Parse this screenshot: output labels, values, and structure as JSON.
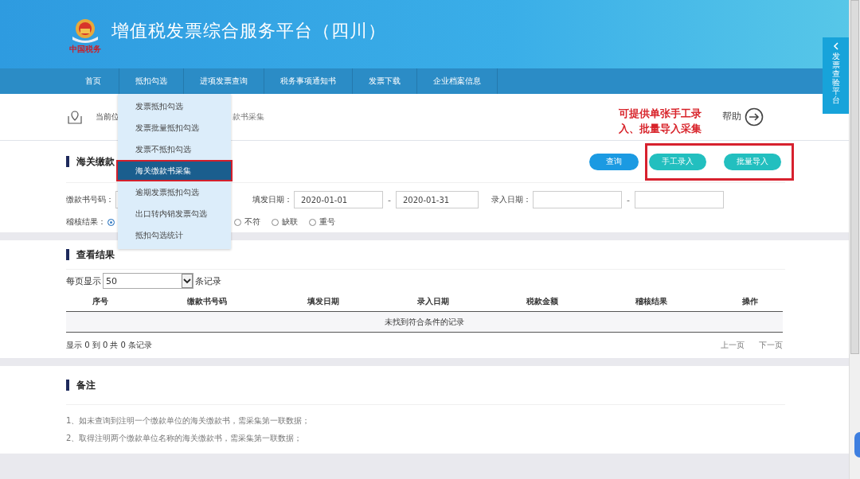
{
  "header": {
    "logo_text": "中国税务",
    "title": "增值税发票综合服务平台（四川）"
  },
  "nav": [
    {
      "label": "首页"
    },
    {
      "label": "抵扣勾选"
    },
    {
      "label": "进项发票查询"
    },
    {
      "label": "税务事项通知书"
    },
    {
      "label": "发票下载"
    },
    {
      "label": "企业档案信息"
    }
  ],
  "dropdown": {
    "items": [
      {
        "label": "发票抵扣勾选",
        "selected": false
      },
      {
        "label": "发票批量抵扣勾选",
        "selected": false
      },
      {
        "label": "发票不抵扣勾选",
        "selected": false
      },
      {
        "label": "海关缴款书采集",
        "selected": true
      },
      {
        "label": "逾期发票抵扣勾选",
        "selected": false
      },
      {
        "label": "出口转内销发票勾选",
        "selected": false
      },
      {
        "label": "抵扣勾选统计",
        "selected": false
      }
    ]
  },
  "side_tab": {
    "label": "发票查验平台"
  },
  "breadcrumb": {
    "prefix": "当前位",
    "current": "款书采集"
  },
  "help": {
    "label": "帮助"
  },
  "annotation": {
    "text": "可提供单张手工录入、批量导入采集"
  },
  "query": {
    "title": "海关缴款",
    "buttons": [
      {
        "label": "查询",
        "kind": "primary"
      },
      {
        "label": "手工录入",
        "kind": "secondary"
      },
      {
        "label": "批量导入",
        "kind": "secondary"
      }
    ],
    "fields": [
      {
        "kind": "text",
        "label": "缴款书号码："
      },
      {
        "kind": "range",
        "label": "填发日期：",
        "from": "2020-01-01",
        "separator": "-",
        "to": "2020-01-31"
      },
      {
        "kind": "range",
        "label": "录入日期：",
        "separator": "-"
      }
    ],
    "radio": {
      "label": "稽核结果：",
      "options": [
        {
          "selected": true
        },
        {
          "label": "不符",
          "selected": false
        },
        {
          "label": "缺联",
          "selected": false
        },
        {
          "label": "重号",
          "selected": false
        }
      ]
    }
  },
  "results": {
    "title": "查看结果",
    "page_size": {
      "prefix": "每页显示",
      "value": "50",
      "suffix": "条记录"
    },
    "columns": [
      "序号",
      "缴款书号码",
      "填发日期",
      "录入日期",
      "税款金额",
      "稽核结果",
      "操作"
    ],
    "empty": "未找到符合条件的记录",
    "summary": "显示 0 到 0 共 0 条记录",
    "pager": [
      "上一页",
      "下一页"
    ]
  },
  "notes": {
    "title": "备注",
    "items": [
      "1、如未查询到注明一个缴款单位的海关缴款书，需采集第一联数据；",
      "2、取得注明两个缴款单位名称的海关缴款书，需采集第一联数据；"
    ]
  }
}
